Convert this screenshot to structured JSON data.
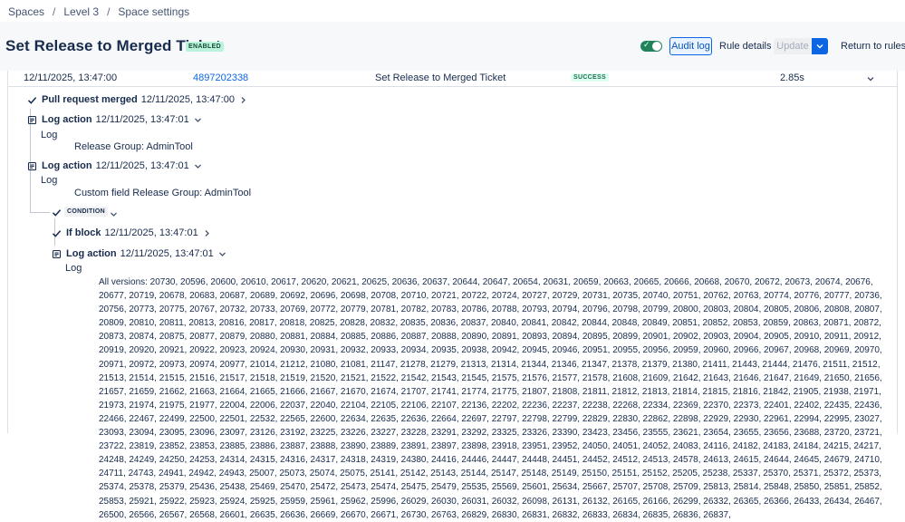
{
  "breadcrumb": {
    "items": [
      "Spaces",
      "Level 3",
      "Space settings"
    ],
    "separator": "/"
  },
  "header": {
    "title": "Set Release to Merged Ticket",
    "status_badge": "ENABLED",
    "toggle_on": true,
    "buttons": {
      "audit_log": "Audit log",
      "rule_details": "Rule details",
      "update": "Update",
      "return": "Return to rules"
    }
  },
  "log_row": {
    "timestamp": "12/11/2025, 13:47:00",
    "id": "4897202338",
    "rule_name": "Set Release to Merged Ticket",
    "status": "SUCCESS",
    "duration": "2.85s"
  },
  "tree": {
    "trigger": {
      "title": "Pull request merged",
      "time": "12/11/2025, 13:47:00"
    },
    "log_action_1": {
      "title": "Log action",
      "time": "12/11/2025, 13:47:01",
      "label": "Log",
      "message": "Release Group: AdminTool"
    },
    "log_action_2": {
      "title": "Log action",
      "time": "12/11/2025, 13:47:01",
      "label": "Log",
      "message": "Custom field Release Group: AdminTool"
    },
    "condition": {
      "badge": "CONDITION"
    },
    "if_block": {
      "title": "If block",
      "time": "12/11/2025, 13:47:01"
    },
    "log_action_3": {
      "title": "Log action",
      "time": "12/11/2025, 13:47:01",
      "label": "Log",
      "message": "All versions: 20730, 20596, 20600, 20610, 20617, 20620, 20621, 20625, 20636, 20637, 20644, 20647, 20654, 20631, 20659, 20663, 20665, 20666, 20668, 20670, 20672, 20673, 20674, 20676, 20677, 20719, 20678, 20683, 20687, 20689, 20692, 20696, 20698, 20708, 20710, 20721, 20722, 20724, 20727, 20729, 20731, 20735, 20740, 20751, 20762, 20763, 20774, 20776, 20777, 20736, 20756, 20773, 20775, 20767, 20732, 20733, 20769, 20772, 20779, 20781, 20782, 20783, 20786, 20788, 20793, 20794, 20796, 20798, 20799, 20800, 20803, 20804, 20805, 20806, 20808, 20807, 20809, 20810, 20811, 20813, 20816, 20817, 20818, 20825, 20828, 20832, 20835, 20836, 20837, 20840, 20841, 20842, 20844, 20848, 20849, 20851, 20852, 20853, 20859, 20863, 20871, 20872, 20873, 20874, 20875, 20877, 20879, 20880, 20881, 20884, 20885, 20886, 20887, 20888, 20890, 20891, 20893, 20894, 20895, 20899, 20901, 20902, 20903, 20904, 20905, 20910, 20911, 20912, 20919, 20920, 20921, 20922, 20923, 20924, 20930, 20931, 20932, 20933, 20934, 20935, 20938, 20942, 20945, 20946, 20951, 20955, 20956, 20959, 20960, 20966, 20967, 20968, 20969, 20970, 20971, 20972, 20973, 20974, 20977, 21014, 21212, 21080, 21081, 21147, 21278, 21279, 21313, 21314, 21344, 21346, 21347, 21378, 21379, 21380, 21411, 21443, 21444, 21476, 21511, 21512, 21513, 21514, 21515, 21516, 21517, 21518, 21519, 21520, 21521, 21522, 21542, 21543, 21545, 21575, 21576, 21577, 21578, 21608, 21609, 21642, 21643, 21646, 21647, 21649, 21650, 21656, 21657, 21659, 21662, 21663, 21664, 21665, 21666, 21667, 21670, 21674, 21707, 21741, 21774, 21775, 21807, 21808, 21811, 21812, 21813, 21814, 21815, 21816, 21842, 21905, 21938, 21971, 21973, 21974, 21975, 21977, 22004, 22006, 22037, 22040, 22104, 22105, 22106, 22107, 22136, 22202, 22236, 22237, 22238, 22268, 22334, 22369, 22370, 22373, 22401, 22402, 22435, 22436, 22466, 22467, 22499, 22500, 22501, 22532, 22565, 22600, 22634, 22635, 22636, 22664, 22697, 22797, 22798, 22799, 22829, 22830, 22862, 22898, 22929, 22930, 22961, 22994, 22995, 23027, 23093, 23094, 23095, 23096, 23097, 23126, 23192, 23225, 23226, 23227, 23228, 23291, 23292, 23325, 23326, 23390, 23423, 23456, 23555, 23621, 23654, 23655, 23656, 23688, 23720, 23721, 23722, 23819, 23852, 23853, 23885, 23886, 23887, 23888, 23890, 23889, 23891, 23897, 23898, 23918, 23951, 23952, 24050, 24051, 24052, 24083, 24116, 24182, 24183, 24184, 24215, 24217, 24248, 24249, 24250, 24253, 24314, 24315, 24316, 24317, 24318, 24319, 24380, 24416, 24446, 24447, 24448, 24451, 24452, 24512, 24513, 24578, 24613, 24615, 24644, 24645, 24679, 24710, 24711, 24743, 24941, 24942, 24943, 25007, 25073, 25074, 25075, 25141, 25142, 25143, 25144, 25147, 25148, 25149, 25150, 25151, 25152, 25205, 25238, 25337, 25370, 25371, 25372, 25373, 25374, 25378, 25379, 25436, 25438, 25469, 25470, 25472, 25473, 25474, 25475, 25479, 25535, 25569, 25601, 25634, 25667, 25707, 25708, 25709, 25813, 25814, 25848, 25850, 25851, 25852, 25853, 25921, 25922, 25923, 25924, 25925, 25959, 25961, 25962, 25996, 26029, 26030, 26031, 26032, 26098, 26131, 26132, 26165, 26166, 26299, 26332, 26365, 26366, 26433, 26434, 26467, 26500, 26566, 26567, 26568, 26601, 26635, 26636, 26669, 26670, 26671, 26730, 26763, 26829, 26830, 26831, 26832, 26833, 26834, 26835, 26836, 26837,"
    }
  },
  "icons": {
    "check": "check-icon",
    "document": "document-icon",
    "chevron_right": "chevron-right-icon",
    "chevron_down": "chevron-down-icon",
    "toggle_check": "toggle-check-icon"
  },
  "colors": {
    "primary": "#0c66e4",
    "enabled_bg": "#baf3db",
    "success_bg": "#dcfff1",
    "toggle_on": "#1f845a",
    "header_bg": "#f7f8f9",
    "text": "#172b4d"
  }
}
